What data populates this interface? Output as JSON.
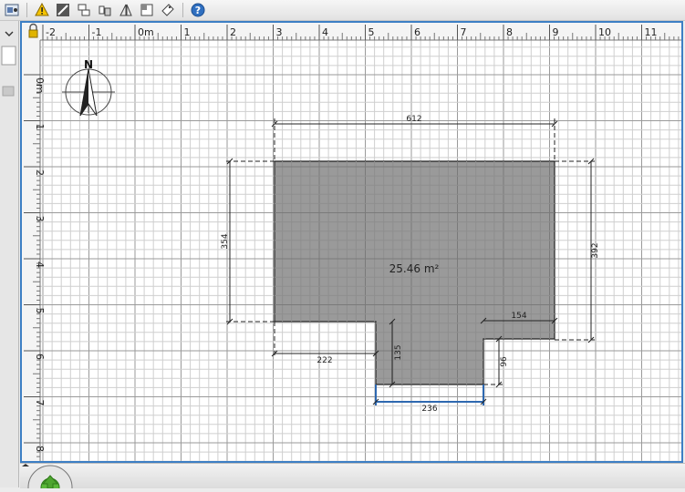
{
  "toolbar": {
    "icons": [
      "preferences-icon",
      "warning-icon",
      "create-walls-icon",
      "create-rooms-icon",
      "create-polylines-icon",
      "create-dimensions-icon",
      "create-labels-icon",
      "add-text-icon",
      "help-icon"
    ]
  },
  "ruler": {
    "x_labels": [
      "-2",
      "-1",
      "0m",
      "1",
      "2",
      "3",
      "4",
      "5",
      "6",
      "7",
      "8",
      "9",
      "10",
      "11"
    ],
    "y_labels": [
      "0m",
      "1",
      "2",
      "3",
      "4",
      "5",
      "6",
      "7",
      "8"
    ]
  },
  "compass": {
    "north_label": "N"
  },
  "room": {
    "area_label": "25.46 m²"
  },
  "dimensions": {
    "top_width": "612",
    "left_height": "354",
    "right_height": "392",
    "bottom_left_step": "222",
    "notch_depth_left": "135",
    "right_step": "154",
    "notch_depth_right": "96",
    "bottom_width": "236"
  },
  "colors": {
    "accent": "#3d7fc4",
    "room_fill": "#999999",
    "grid_minor": "#cfcfcf",
    "grid_major": "#9a9a9a"
  }
}
